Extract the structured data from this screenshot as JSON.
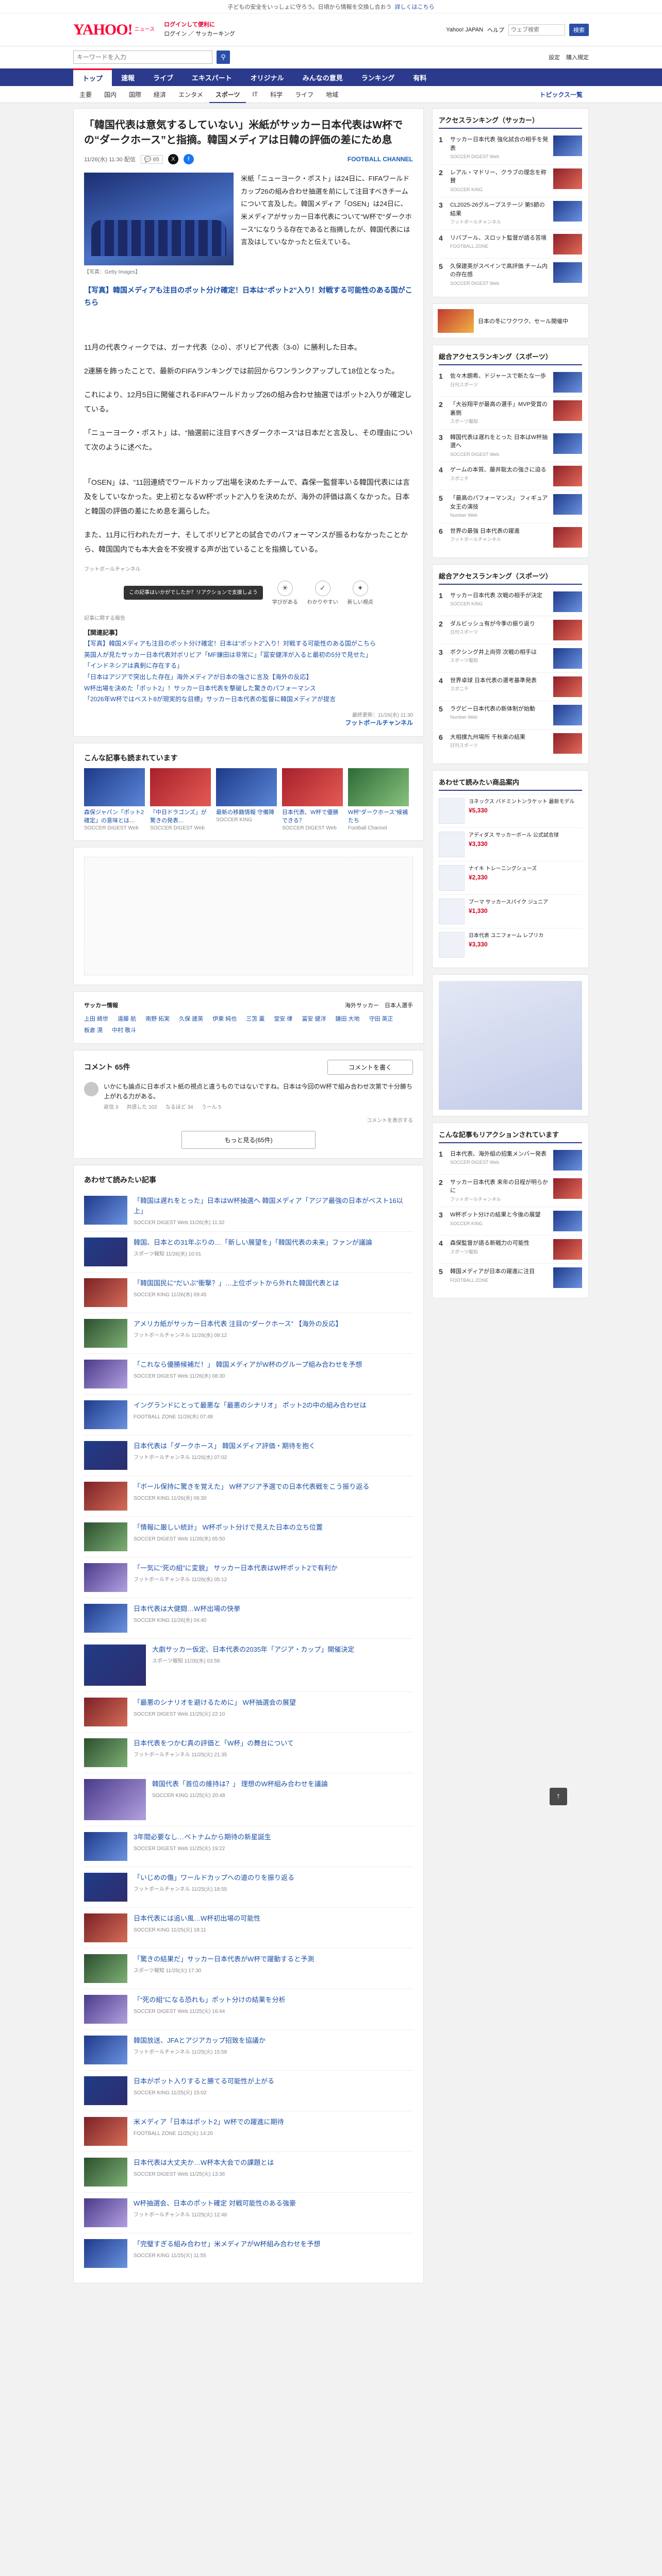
{
  "topline": {
    "text": "子どもの安全をいっしょに守ろう。日頃から情報を交換し合おう",
    "link": "詳しくはこちら"
  },
  "header": {
    "logo": "YAHOO!",
    "logo_sub": "ニュース",
    "links": [
      "ログインして便利に",
      "ログイン"
    ],
    "promo": "サッカーキング",
    "right_links": [
      "Yahoo! JAPAN",
      "ヘルプ"
    ],
    "search_placeholder": "ウェブ検索",
    "search_button": "検索"
  },
  "searchbar": {
    "placeholder": "キーワードを入力",
    "right": [
      "設定",
      "購入規定"
    ]
  },
  "nav": [
    "トップ",
    "速報",
    "ライブ",
    "エキスパート",
    "オリジナル",
    "みんなの意見",
    "ランキング",
    "有料"
  ],
  "subnav": [
    "主要",
    "国内",
    "国際",
    "経済",
    "エンタメ",
    "スポーツ",
    "IT",
    "科学",
    "ライフ",
    "地域"
  ],
  "subnav_topics": "トピックス一覧",
  "article": {
    "title": "「韓国代表は意気するしていない」米紙がサッカー日本代表はW杯での“ダークホース”と指摘。韓国メディアは日韓の評価の差にため息",
    "date": "11/26(水) 11:30 配信",
    "comments": "65",
    "provider": "FOOTBALL CHANNEL",
    "photo_caption": "【写真：Getty Images】",
    "lead": "米紙「ニューヨーク・ポスト」は24日に、FIFAワールドカップ26の組み合わせ抽選を前にして注目すべきチームについて言及した。韓国メディア「OSEN」は24日に、米メディアがサッカー日本代表について“W杯で“ダークホース”になりうる存在であると指摘したが、韓国代表には言及はしていなかったと伝えている。",
    "link1": "【写真】韓国メディアも注目のポット分け確定！日本は“ポット2”入り！対戦する可能性のある国がこちら",
    "paras": [
      "11月の代表ウィークでは、ガーナ代表（2-0）、ボリビア代表（3-0）に勝利した日本。",
      "2連勝を飾ったことで、最新のFIFAランキングでは前回からワンランクアップして18位となった。",
      "これにより、12月5日に開催されるFIFAワールドカップ26の組み合わせ抽選ではポット2入りが確定している。",
      "「ニューヨーク・ポスト」は、“抽選前に注目すべきダークホース”は日本だと言及し、その理由について次のように述べた。",
      "「OSEN」は、“11回連続でワールドカップ出場を決めたチームで、森保一監督率いる韓国代表には言及をしていなかった。史上初となるW杯“ポット2”入りを決めたが、海外の評価は高くなかった。日本と韓国の評価の差にため息を漏らした。",
      "また、11月に行われたガーナ、そしてボリビアとの試合でのパフォーマンスが振るわなかったことから、韓国国内でも本大会を不安視する声が出ていることを指摘している。"
    ],
    "photo_credit": "フットボールチャンネル",
    "reaction_tip": "この記事はいかがでしたか？リアクションで支援しよう",
    "reactions": [
      "学びがある",
      "わかりやすい",
      "新しい視点"
    ],
    "report": "記事に関する報告",
    "related_head": "【関連記事】",
    "related": [
      "【写真】韓国メディアも注目のポット分け確定！日本は“ポット2”入り！対戦する可能性のある国がこちら",
      "英国人が見たサッカー日本代表対ボリビア「MF鎌田は非常に」「冨安健洋が入ると最初の5分で見せた」",
      "「インドネシアは真剣に存在する」",
      "「日本はアジアで突出した存在」海外メディアが日本の強さに言及【海外の反応】",
      "W杯出場を決めた「ポット2」！サッカー日本代表を撃破した驚きのパフォーマンス",
      "「2026年W杯ではベスト8が現実的な目標」サッカー日本代表の監督に韓国メディアが提言"
    ],
    "footer_date": "最終更新：11/26(水) 11:30",
    "footer_provider": "フットボールチャンネル"
  },
  "readers": {
    "title": "こんな記事も読まれています",
    "items": [
      {
        "t": "森保ジャパン「ポット2確定」の意味とは…",
        "s": "SOCCER DIGEST Web"
      },
      {
        "t": "「中日ドラゴンズ」が驚きの発表…",
        "s": "SOCCER DIGEST Web"
      },
      {
        "t": "最新の移籍情報 守備陣",
        "s": "SOCCER KING"
      },
      {
        "t": "日本代表、W杯で優勝できる？",
        "s": "SOCCER DIGEST Web"
      },
      {
        "t": "W杯“ダークホース”候補たち",
        "s": "Football Channel"
      }
    ]
  },
  "tags": {
    "left": "サッカー情報",
    "right": "海外サッカー　日本人選手",
    "chips": [
      "上田 綺世",
      "遠藤 航",
      "南野 拓実",
      "久保 建英",
      "伊東 純也",
      "三笘 薫",
      "堂安 律",
      "冨安 健洋",
      "鎌田 大地",
      "守田 英正",
      "板倉 滉",
      "中村 敬斗"
    ]
  },
  "comments": {
    "title": "コメント 65件",
    "post": "コメントを書く",
    "first": "いかにも論点に日本ポスト紙の視点と違うものではないですね。日本は今回のW杯で組み合わせ次第で十分勝ち上がれる力がある。",
    "first_meta": [
      "返信 3",
      "共感した 102",
      "なるほど 34",
      "うーん 5"
    ],
    "notice": "コメントを表示する",
    "more": "もっと見る(65件)"
  },
  "recommended": {
    "title": "あわせて読みたい記事",
    "items": [
      {
        "t": "「韓国は遅れをとった」日本はW杯抽選へ 韓国メディア「アジア最強の日本がベスト16以上」",
        "s": "SOCCER DIGEST Web 11/26(水) 11:32"
      },
      {
        "t": "韓国、日本との31年ぶりの…「新しい展望を」「韓国代表の未来」ファンが議論",
        "s": "スポーツ報知 11/26(水) 10:01"
      },
      {
        "t": "「韓国国民に“だいぶ”衝撃？」…上位ポットから外れた韓国代表とは",
        "s": "SOCCER KING 11/26(水) 09:45"
      },
      {
        "t": "アメリカ紙がサッカー日本代表 注目の“ダークホース” 【海外の反応】",
        "s": "フットボールチャンネル 11/26(水) 09:12"
      },
      {
        "t": "「これなら優勝候補だ！」 韓国メディアがW杯のグループ組み合わせを予想",
        "s": "SOCCER DIGEST Web 11/26(水) 08:30"
      },
      {
        "t": "イングランドにとって最悪な「最悪のシナリオ」 ポット2の中の組み合わせは",
        "s": "FOOTBALL ZONE 11/26(水) 07:48"
      },
      {
        "t": "日本代表は「ダークホース」 韓国メディア評価・期待を抱く",
        "s": "フットボールチャンネル 11/26(水) 07:02"
      },
      {
        "t": "「ボール保持に驚きを覚えた」 W杯アジア予選での日本代表戦をこう振り返る",
        "s": "SOCCER KING 11/26(水) 06:30"
      },
      {
        "t": "「情報に厳しい統計」 W杯ポット分けで見えた日本の立ち位置",
        "s": "SOCCER DIGEST Web 11/26(水) 05:50"
      },
      {
        "t": "「一気に“死の組”に変貌」 サッカー日本代表はW杯ポット2で有利か",
        "s": "フットボールチャンネル 11/26(水) 05:12"
      },
      {
        "t": "日本代表は大健闘…W杯出場の快挙",
        "s": "SOCCER KING 11/26(水) 04:40"
      },
      {
        "t": "大劇サッカー仮定、日本代表の2035年「アジア・カップ」開催決定",
        "s": "スポーツ報知 11/26(水) 03:58"
      },
      {
        "t": "「最悪のシナリオを避けるために」 W杯抽選会の展望",
        "s": "SOCCER DIGEST Web 11/25(火) 22:10"
      },
      {
        "t": "日本代表をつかむ真の評価と「W杯」の舞台について",
        "s": "フットボールチャンネル 11/25(火) 21:35"
      },
      {
        "t": "韓国代表「首位の維持は？」 理想のW杯組み合わせを議論",
        "s": "SOCCER KING 11/25(火) 20:48"
      },
      {
        "t": "3年間必要なし…ベトナムから期待の新星誕生",
        "s": "SOCCER DIGEST Web 11/25(火) 19:22"
      },
      {
        "t": "「いじめの傷」ワールドカップへの道のりを振り返る",
        "s": "フットボールチャンネル 11/25(火) 18:55"
      },
      {
        "t": "日本代表には追い風…W杯初出場の可能性",
        "s": "SOCCER KING 11/25(火) 18:11"
      },
      {
        "t": "「驚きの結果だ」サッカー日本代表がW杯で躍動すると予測",
        "s": "スポーツ報知 11/25(火) 17:30"
      },
      {
        "t": "「“死の組”になる恐れも」ポット分けの結果を分析",
        "s": "SOCCER DIGEST Web 11/25(火) 16:44"
      },
      {
        "t": "韓国放送、JFAとアジアカップ招致を協議か",
        "s": "フットボールチャンネル 11/25(火) 15:58"
      },
      {
        "t": "日本がポット入りすると勝てる可能性が上がる",
        "s": "SOCCER KING 11/25(火) 15:02"
      },
      {
        "t": "米メディア「日本はポット2」W杯での躍進に期待",
        "s": "FOOTBALL ZONE 11/25(火) 14:20"
      },
      {
        "t": "日本代表は大丈夫か…W杯本大会での課題とは",
        "s": "SOCCER DIGEST Web 11/25(火) 13:36"
      },
      {
        "t": "W杯抽選会、日本のポット確定 対戦可能性のある強豪",
        "s": "フットボールチャンネル 11/25(火) 12:48"
      },
      {
        "t": "「完璧すぎる組み合わせ」米メディアがW杯組み合わせを予想",
        "s": "SOCCER KING 11/25(火) 11:55"
      }
    ]
  },
  "sidebar": {
    "ranking_title": "アクセスランキング（サッカー）",
    "ranking": [
      {
        "t": "サッカー日本代表 強化試合の相手を発表",
        "s": "SOCCER DIGEST Web"
      },
      {
        "t": "レアル・マドリー、クラブの理念を称賛",
        "s": "SOCCER KING"
      },
      {
        "t": "CL2025-26グループステージ 第5節の結果",
        "s": "フットボールチャンネル"
      },
      {
        "t": "リバプール、スロット監督が語る苦境",
        "s": "FOOTBALL ZONE"
      },
      {
        "t": "久保建英がスペインで高評価 チーム内の存在感",
        "s": "SOCCER DIGEST Web"
      }
    ],
    "banner": "日本の冬にワクワク、セール開催中",
    "sports_title": "総合アクセスランキング（スポーツ）",
    "sports": [
      {
        "t": "佐々木朗希、ドジャースで新たな一歩",
        "s": "日刊スポーツ"
      },
      {
        "t": "「大谷翔平が最高の選手」MVP受賞の裏側",
        "s": "スポーツ報知"
      },
      {
        "t": "韓国代表は遅れをとった 日本はW杯抽選へ",
        "s": "SOCCER DIGEST Web"
      },
      {
        "t": "ゲームの本質、藤井聡太の強さに迫る",
        "s": "スポニチ"
      },
      {
        "t": "「最高のパフォーマンス」 フィギュア女王の演技",
        "s": "Number Web"
      },
      {
        "t": "世界の最強 日本代表の躍進",
        "s": "フットボールチャンネル"
      }
    ],
    "sports2_title": "総合アクセスランキング（スポーツ）",
    "sports2": [
      {
        "t": "サッカー日本代表 次戦の相手が決定",
        "s": "SOCCER KING"
      },
      {
        "t": "ダルビッシュ有が今季の振り返り",
        "s": "日刊スポーツ"
      },
      {
        "t": "ボクシング井上尚弥 次戦の相手は",
        "s": "スポーツ報知"
      },
      {
        "t": "世界卓球 日本代表の選考基準発表",
        "s": "スポニチ"
      },
      {
        "t": "ラグビー日本代表の新体制が始動",
        "s": "Number Web"
      },
      {
        "t": "大相撲九州場所 千秋楽の結果",
        "s": "日刊スポーツ"
      }
    ],
    "shop_title": "あわせて読みたい商品案内",
    "shop": [
      {
        "t": "ヨネックス バドミントンラケット 最新モデル",
        "p": "¥5,330"
      },
      {
        "t": "アディダス サッカーボール 公式試合球",
        "p": "¥3,330"
      },
      {
        "t": "ナイキ トレーニングシューズ",
        "p": "¥2,330"
      },
      {
        "t": "プーマ サッカースパイク ジュニア",
        "p": "¥1,330"
      },
      {
        "t": "日本代表 ユニフォーム レプリカ",
        "p": "¥3,330"
      }
    ],
    "recommend_title": "こんな記事もリアクションされています",
    "recommend": [
      {
        "t": "日本代表、海外組の招集メンバー発表",
        "s": "SOCCER DIGEST Web"
      },
      {
        "t": "サッカー日本代表 来年の日程が明らかに",
        "s": "フットボールチャンネル"
      },
      {
        "t": "W杯ポット分けの結果と今後の展望",
        "s": "SOCCER KING"
      },
      {
        "t": "森保監督が語る新戦力の可能性",
        "s": "スポーツ報知"
      },
      {
        "t": "韓国メディアが日本の躍進に注目",
        "s": "FOOTBALL ZONE"
      }
    ]
  }
}
